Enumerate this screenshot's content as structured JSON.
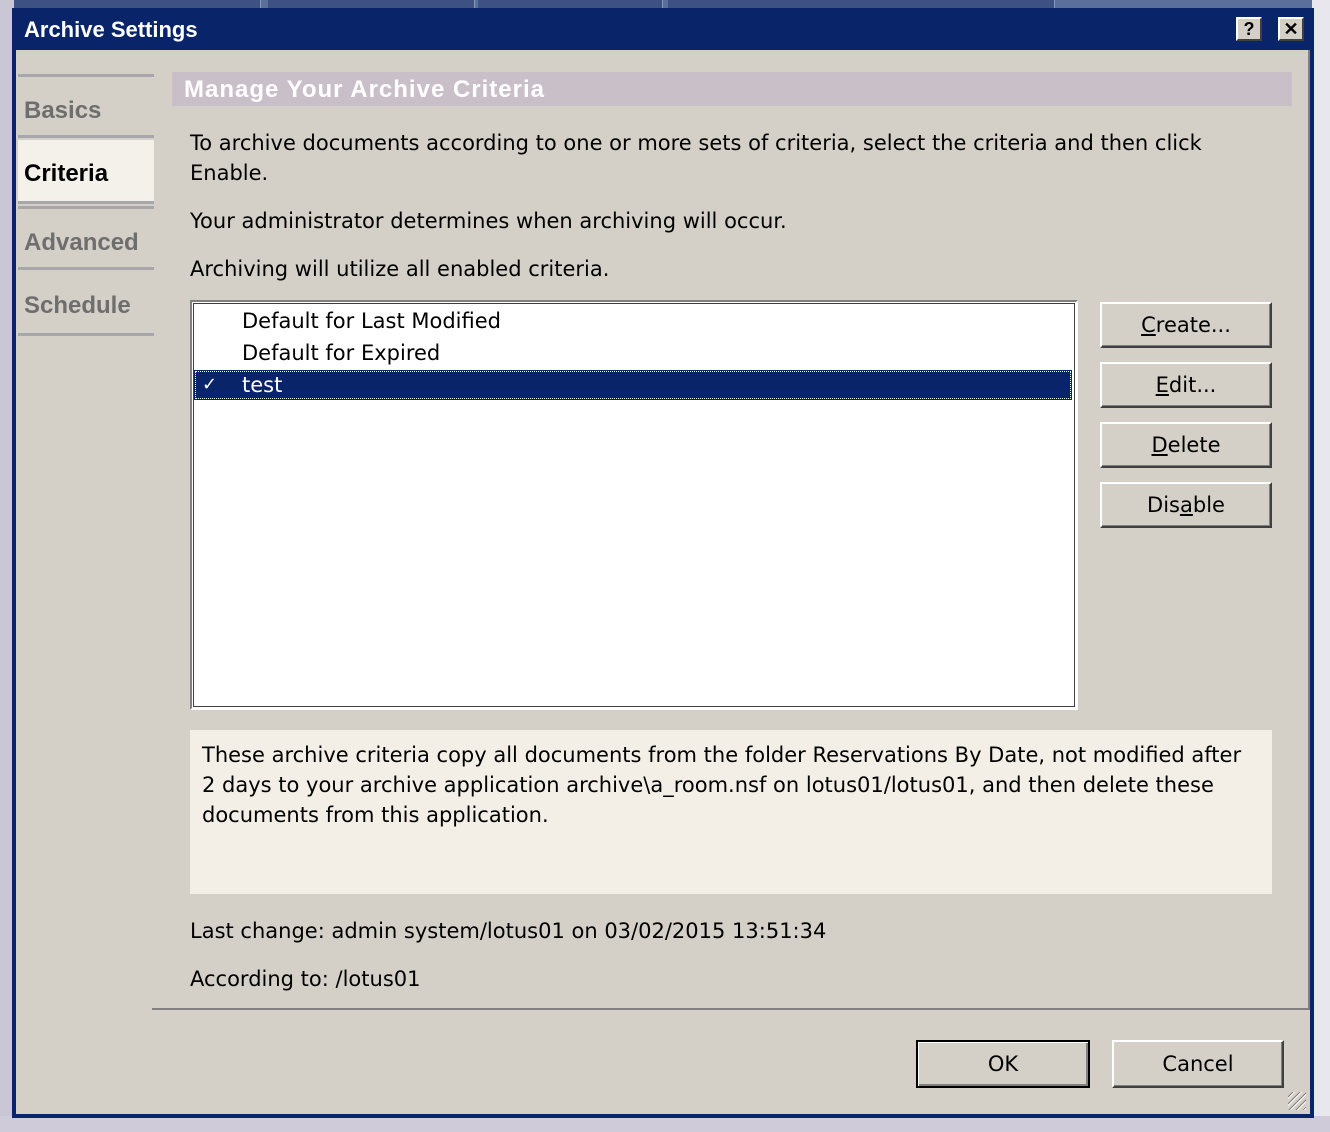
{
  "dialog": {
    "title": "Archive Settings",
    "help_label": "?",
    "close_label": "✕"
  },
  "tabs": [
    {
      "label": "Basics",
      "active": false
    },
    {
      "label": "Criteria",
      "active": true
    },
    {
      "label": "Advanced",
      "active": false
    },
    {
      "label": "Schedule",
      "active": false
    }
  ],
  "panel": {
    "header": "Manage Your Archive Criteria",
    "intro": "To archive documents according to one or more sets of criteria, select the criteria and then click Enable.",
    "admin_note": "Your administrator determines when archiving will occur.",
    "enabled_note": "Archiving will utilize all enabled criteria."
  },
  "criteria_list": [
    {
      "label": "Default for Last Modified",
      "checked": false,
      "selected": false
    },
    {
      "label": "Default for Expired",
      "checked": false,
      "selected": false
    },
    {
      "label": "test",
      "checked": true,
      "selected": true
    }
  ],
  "check_glyph": "✓",
  "actions": {
    "create": {
      "pre": "",
      "ul": "C",
      "post": "reate..."
    },
    "edit": {
      "pre": "",
      "ul": "E",
      "post": "dit..."
    },
    "delete": {
      "pre": "",
      "ul": "D",
      "post": "elete"
    },
    "disable": {
      "pre": "Dis",
      "ul": "a",
      "post": "ble"
    }
  },
  "description": "These archive criteria copy all documents from the folder Reservations By Date, not modified after 2 days to your archive application archive\\a_room.nsf on lotus01/lotus01, and then delete these documents from this application.",
  "last_change": "Last change: admin system/lotus01 on 03/02/2015 13:51:34",
  "according_to": "According to: /lotus01",
  "footer": {
    "ok": "OK",
    "cancel": "Cancel"
  }
}
